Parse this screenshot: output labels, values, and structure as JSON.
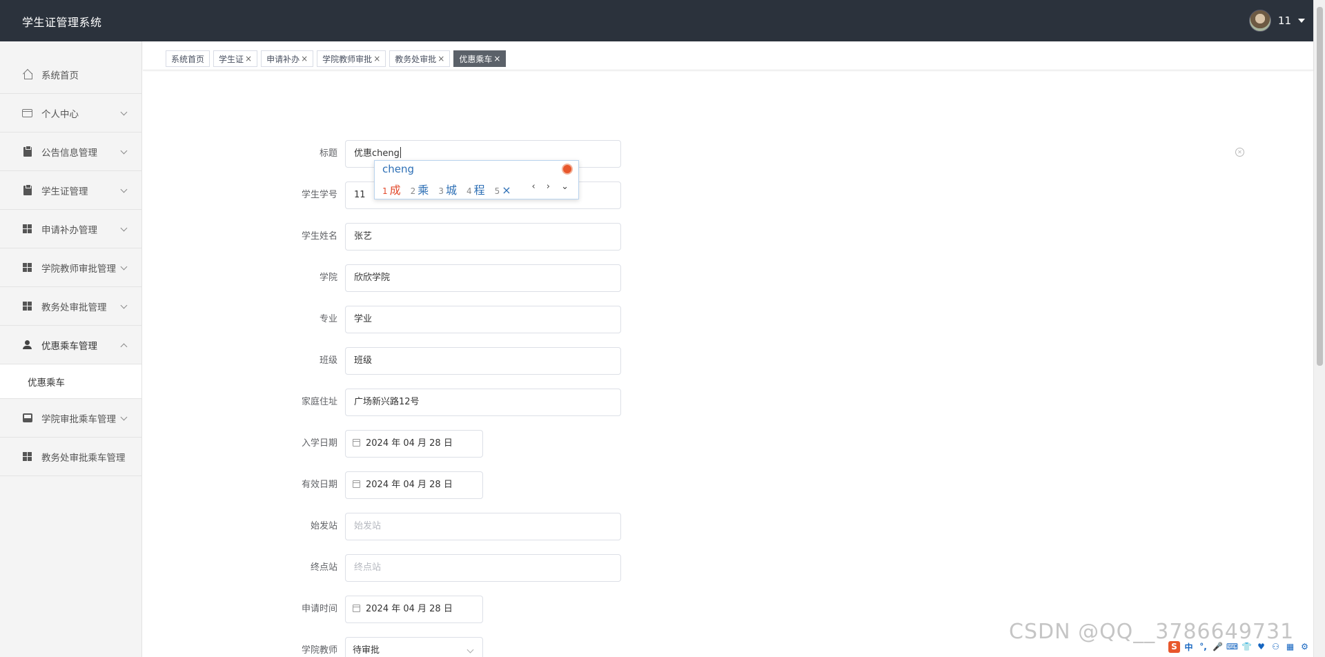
{
  "app": {
    "title": "学生证管理系统"
  },
  "user": {
    "name": "11"
  },
  "sidebar": {
    "items": [
      {
        "label": "系统首页",
        "icon": "home-icon"
      },
      {
        "label": "个人中心",
        "icon": "card-icon"
      },
      {
        "label": "公告信息管理",
        "icon": "clipboard-icon"
      },
      {
        "label": "学生证管理",
        "icon": "clipboard-icon"
      },
      {
        "label": "申请补办管理",
        "icon": "grid-icon"
      },
      {
        "label": "学院教师审批管理",
        "icon": "grid-icon"
      },
      {
        "label": "教务处审批管理",
        "icon": "grid-icon"
      },
      {
        "label": "优惠乘车管理",
        "icon": "user-icon"
      },
      {
        "label": "学院审批乘车管理",
        "icon": "bus-icon"
      },
      {
        "label": "教务处审批乘车管理",
        "icon": "grid-icon"
      }
    ],
    "submenu": {
      "label": "优惠乘车"
    }
  },
  "tabs": [
    {
      "label": "系统首页",
      "closable": false
    },
    {
      "label": "学生证",
      "closable": true
    },
    {
      "label": "申请补办",
      "closable": true
    },
    {
      "label": "学院教师审批",
      "closable": true
    },
    {
      "label": "教务处审批",
      "closable": true
    },
    {
      "label": "优惠乘车",
      "closable": true,
      "active": true
    }
  ],
  "tab_close_glyph": "×",
  "form": {
    "title": {
      "label": "标题",
      "value": "优惠cheng"
    },
    "student_no": {
      "label": "学生学号",
      "value": "11"
    },
    "student_name": {
      "label": "学生姓名",
      "value": "张艺"
    },
    "college": {
      "label": "学院",
      "value": "欣欣学院"
    },
    "major": {
      "label": "专业",
      "value": "学业"
    },
    "class": {
      "label": "班级",
      "value": "班级"
    },
    "address": {
      "label": "家庭住址",
      "value": "广场新兴路12号"
    },
    "enroll_date": {
      "label": "入学日期",
      "value": "2024 年 04 月 28 日"
    },
    "valid_date": {
      "label": "有效日期",
      "value": "2024 年 04 月 28 日"
    },
    "start_station": {
      "label": "始发站",
      "placeholder": "始发站"
    },
    "end_station": {
      "label": "终点站",
      "placeholder": "终点站"
    },
    "apply_time": {
      "label": "申请时间",
      "value": "2024 年 04 月 28 日"
    },
    "teacher": {
      "label": "学院教师",
      "value": "待审批"
    }
  },
  "ime": {
    "composition": "cheng",
    "candidates": [
      {
        "n": "1",
        "text": "成"
      },
      {
        "n": "2",
        "text": "乘"
      },
      {
        "n": "3",
        "text": "城"
      },
      {
        "n": "4",
        "text": "程"
      },
      {
        "n": "5",
        "text": "×"
      }
    ],
    "nav": "‹ › ⌄"
  },
  "watermark": "CSDN @QQ__3786649731",
  "tray": [
    "S",
    "中",
    "°,",
    "🎤",
    "⌨",
    "👕",
    "♥",
    "⚇",
    "▦",
    "⚙"
  ],
  "colors": {
    "header_bg": "#2b323c",
    "active_tab_bg": "#5b6169",
    "ime_candidate": "#2d6fb5",
    "ime_selected": "#e24a2c"
  }
}
